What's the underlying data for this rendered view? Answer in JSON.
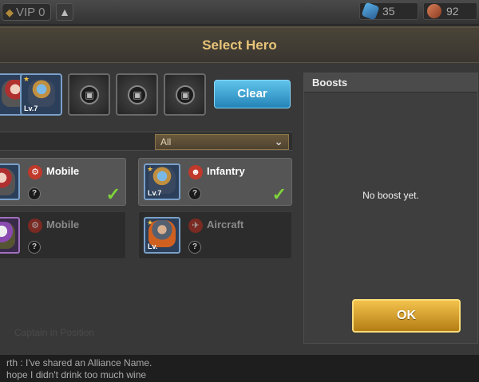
{
  "topbar": {
    "vip_label": "VIP 0",
    "gem_icon": "diamond-icon",
    "up_icon": "arrow-up-icon",
    "resources": [
      {
        "icon": "crystal-icon",
        "value": "35"
      },
      {
        "icon": "food-icon",
        "value": "92"
      }
    ]
  },
  "modal": {
    "title": "Select Hero",
    "slots": [
      {
        "type": "hero",
        "level": ""
      },
      {
        "type": "hero",
        "level": "Lv.7"
      },
      {
        "type": "locked"
      },
      {
        "type": "locked"
      },
      {
        "type": "locked"
      }
    ],
    "clear_label": "Clear",
    "filter": {
      "selected": "All"
    },
    "heroes": [
      {
        "type": "Mobile",
        "selected": true,
        "level": ""
      },
      {
        "type": "Infantry",
        "selected": true,
        "level": "Lv.7"
      },
      {
        "type": "Mobile",
        "selected": false,
        "level": ""
      },
      {
        "type": "Aircraft",
        "selected": false,
        "level": "Lv."
      }
    ],
    "question_mark": "?",
    "boosts": {
      "header": "Boosts",
      "empty_text": "No boost yet."
    },
    "ok_label": "OK"
  },
  "background": {
    "faded_text": "Captain in Position"
  },
  "chat": {
    "line1": "rth : I've shared an Alliance Name.",
    "line2": "hope I didn't drink too much wine"
  },
  "colors": {
    "title": "#e7c478",
    "clear_button": "#3aa6d8",
    "ok_button": "#e0a22c",
    "check": "#7fd43a"
  }
}
